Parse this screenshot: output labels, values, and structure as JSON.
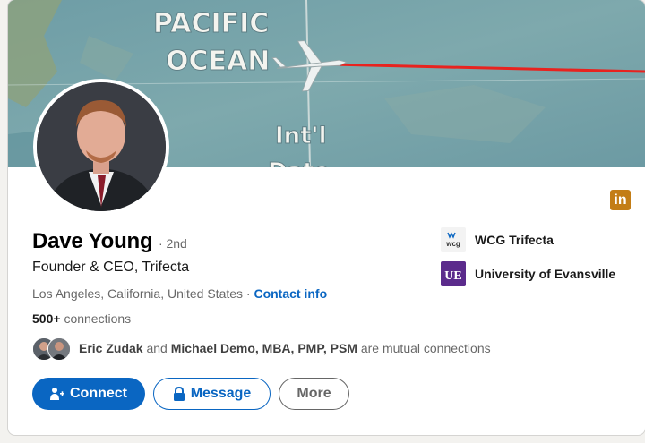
{
  "banner": {
    "ocean_text_line1": "PACIFIC",
    "ocean_text_line2": "OCEAN",
    "dateline_text_line1": "Int'l",
    "dateline_text_line2": "Date"
  },
  "badge": {
    "label": "in"
  },
  "profile": {
    "name": "Dave Young",
    "degree": "· 2nd",
    "headline": "Founder & CEO, Trifecta",
    "location": "Los Angeles, California, United States ·",
    "contact_link": "Contact info",
    "connections_count": "500+",
    "connections_label": "connections"
  },
  "mutual": {
    "person1": "Eric Zudak",
    "joiner": "and",
    "person2": "Michael Demo, MBA, PMP, PSM",
    "suffix": "are mutual connections"
  },
  "actions": {
    "connect_label": "Connect",
    "message_label": "Message",
    "more_label": "More"
  },
  "organizations": [
    {
      "name": "WCG Trifecta",
      "logo_text": "wcg"
    },
    {
      "name": "University of Evansville",
      "logo_text": "UE"
    }
  ],
  "colors": {
    "primary": "#0a66c2",
    "badge": "#c37d16",
    "ue_purple": "#5b2b8c",
    "flight_path": "#e8231f"
  }
}
